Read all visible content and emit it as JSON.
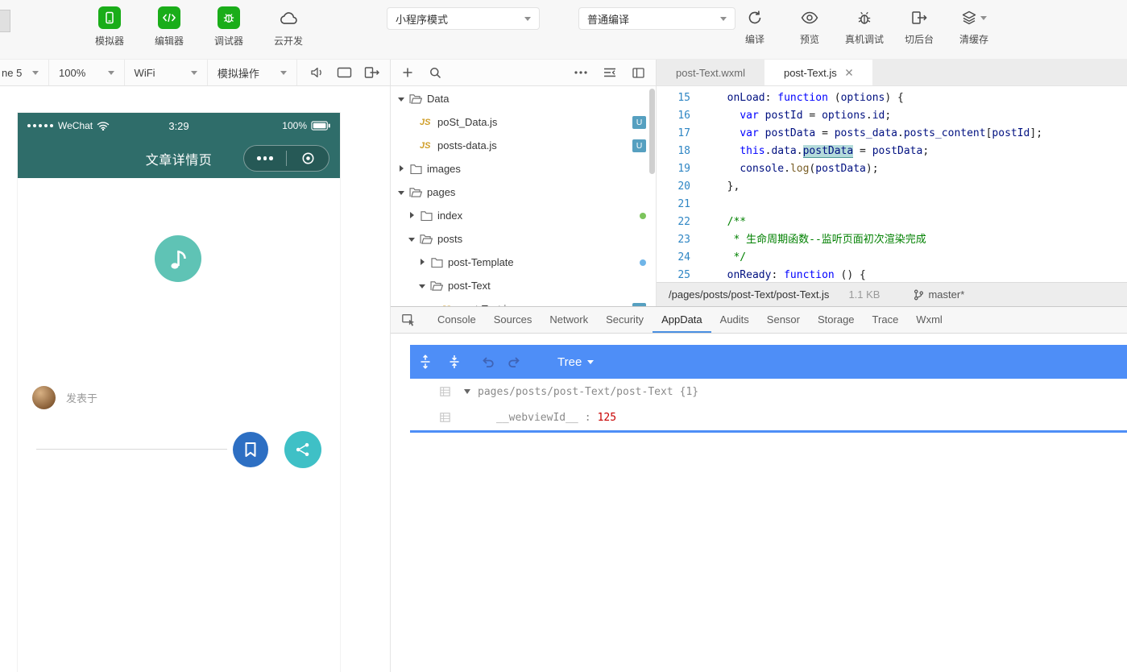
{
  "colors": {
    "brand_green": "#1aad19",
    "phone_bar_teal": "#2f6d6a",
    "logo_teal": "#5fc3b5",
    "bookmark_blue": "#2d6fc3",
    "share_teal": "#3fc0c6",
    "appdata_toolbar_blue": "#4e8ef7",
    "value_red": "#c80000",
    "git_badge_blue": "#56a0c0"
  },
  "topbar": {
    "tools": [
      {
        "label": "模拟器"
      },
      {
        "label": "编辑器"
      },
      {
        "label": "调试器"
      },
      {
        "label": "云开发"
      }
    ],
    "mode_select": "小程序模式",
    "compile_select": "普通编译",
    "actions": [
      {
        "label": "编译"
      },
      {
        "label": "预览"
      },
      {
        "label": "真机调试"
      },
      {
        "label": "切后台"
      },
      {
        "label": "清缓存"
      }
    ]
  },
  "device_bar": {
    "device": "ne 5",
    "zoom": "100%",
    "network": "WiFi",
    "sim_action": "模拟操作"
  },
  "simulator": {
    "carrier": "WeChat",
    "time": "3:29",
    "battery": "100%",
    "nav_title": "文章详情页",
    "publish_label": "发表于"
  },
  "file_tree": {
    "items": [
      {
        "label": "Data",
        "type": "folder",
        "expanded": true,
        "depth": 0
      },
      {
        "label": "poSt_Data.js",
        "type": "js",
        "depth": 1,
        "badge": "U"
      },
      {
        "label": "posts-data.js",
        "type": "js",
        "depth": 1,
        "badge": "U"
      },
      {
        "label": "images",
        "type": "folder",
        "expanded": false,
        "depth": 0
      },
      {
        "label": "pages",
        "type": "folder",
        "expanded": true,
        "depth": 0
      },
      {
        "label": "index",
        "type": "folder",
        "expanded": false,
        "depth": 1,
        "dot": "#7cc45c"
      },
      {
        "label": "posts",
        "type": "folder",
        "expanded": true,
        "depth": 1
      },
      {
        "label": "post-Template",
        "type": "folder",
        "expanded": false,
        "depth": 2,
        "dot": "#6fb5e8"
      },
      {
        "label": "post-Text",
        "type": "folder",
        "expanded": true,
        "depth": 2
      },
      {
        "label": "post-Text.js",
        "type": "js",
        "depth": 3,
        "badge": "U"
      }
    ]
  },
  "editor": {
    "tabs": [
      {
        "label": "post-Text.wxml"
      },
      {
        "label": "post-Text.js"
      }
    ],
    "code": {
      "lines": [
        {
          "num": 15,
          "t": [
            [
              "pl",
              "  "
            ],
            [
              "id",
              "onLoad"
            ],
            [
              "pl",
              ": "
            ],
            [
              "kw",
              "function"
            ],
            [
              "pl",
              " ("
            ],
            [
              "id",
              "options"
            ],
            [
              "pl",
              ") {"
            ]
          ]
        },
        {
          "num": 16,
          "t": [
            [
              "pl",
              "    "
            ],
            [
              "kw",
              "var"
            ],
            [
              "pl",
              " "
            ],
            [
              "id",
              "postId"
            ],
            [
              "pl",
              " = "
            ],
            [
              "id",
              "options"
            ],
            [
              "pl",
              "."
            ],
            [
              "id",
              "id"
            ],
            [
              "pl",
              ";"
            ]
          ]
        },
        {
          "num": 17,
          "t": [
            [
              "pl",
              "    "
            ],
            [
              "kw",
              "var"
            ],
            [
              "pl",
              " "
            ],
            [
              "id",
              "postData"
            ],
            [
              "pl",
              " = "
            ],
            [
              "id",
              "posts_data"
            ],
            [
              "pl",
              "."
            ],
            [
              "id",
              "posts_content"
            ],
            [
              "pl",
              "["
            ],
            [
              "id",
              "postId"
            ],
            [
              "pl",
              "];"
            ]
          ]
        },
        {
          "num": 18,
          "t": [
            [
              "pl",
              "    "
            ],
            [
              "kw",
              "this"
            ],
            [
              "pl",
              "."
            ],
            [
              "id",
              "data"
            ],
            [
              "pl",
              "."
            ],
            [
              "hl",
              "postData"
            ],
            [
              "pl",
              " = "
            ],
            [
              "id",
              "postData"
            ],
            [
              "pl",
              ";"
            ]
          ]
        },
        {
          "num": 19,
          "t": [
            [
              "pl",
              "    "
            ],
            [
              "id",
              "console"
            ],
            [
              "pl",
              "."
            ],
            [
              "fn",
              "log"
            ],
            [
              "pl",
              "("
            ],
            [
              "id",
              "postData"
            ],
            [
              "pl",
              ");"
            ]
          ]
        },
        {
          "num": 20,
          "t": [
            [
              "pl",
              "  },"
            ]
          ]
        },
        {
          "num": 21,
          "t": []
        },
        {
          "num": 22,
          "t": [
            [
              "cm",
              "  /**"
            ]
          ]
        },
        {
          "num": 23,
          "t": [
            [
              "cm",
              "   * 生命周期函数--监听页面初次渲染完成"
            ]
          ]
        },
        {
          "num": 24,
          "t": [
            [
              "cm",
              "   */"
            ]
          ]
        },
        {
          "num": 25,
          "t": [
            [
              "pl",
              "  "
            ],
            [
              "id",
              "onReady"
            ],
            [
              "pl",
              ": "
            ],
            [
              "kw",
              "function"
            ],
            [
              "pl",
              " () {"
            ]
          ]
        }
      ]
    },
    "status": {
      "path": "/pages/posts/post-Text/post-Text.js",
      "size": "1.1 KB",
      "branch": "master*"
    }
  },
  "devtools": {
    "tabs": [
      "Console",
      "Sources",
      "Network",
      "Security",
      "AppData",
      "Audits",
      "Sensor",
      "Storage",
      "Trace",
      "Wxml"
    ],
    "active_tab": "AppData",
    "appdata": {
      "view": "Tree",
      "root_path": "pages/posts/post-Text/post-Text",
      "root_meta": "{1}",
      "key": "__webviewId__",
      "sep": ":",
      "value": "125"
    }
  }
}
